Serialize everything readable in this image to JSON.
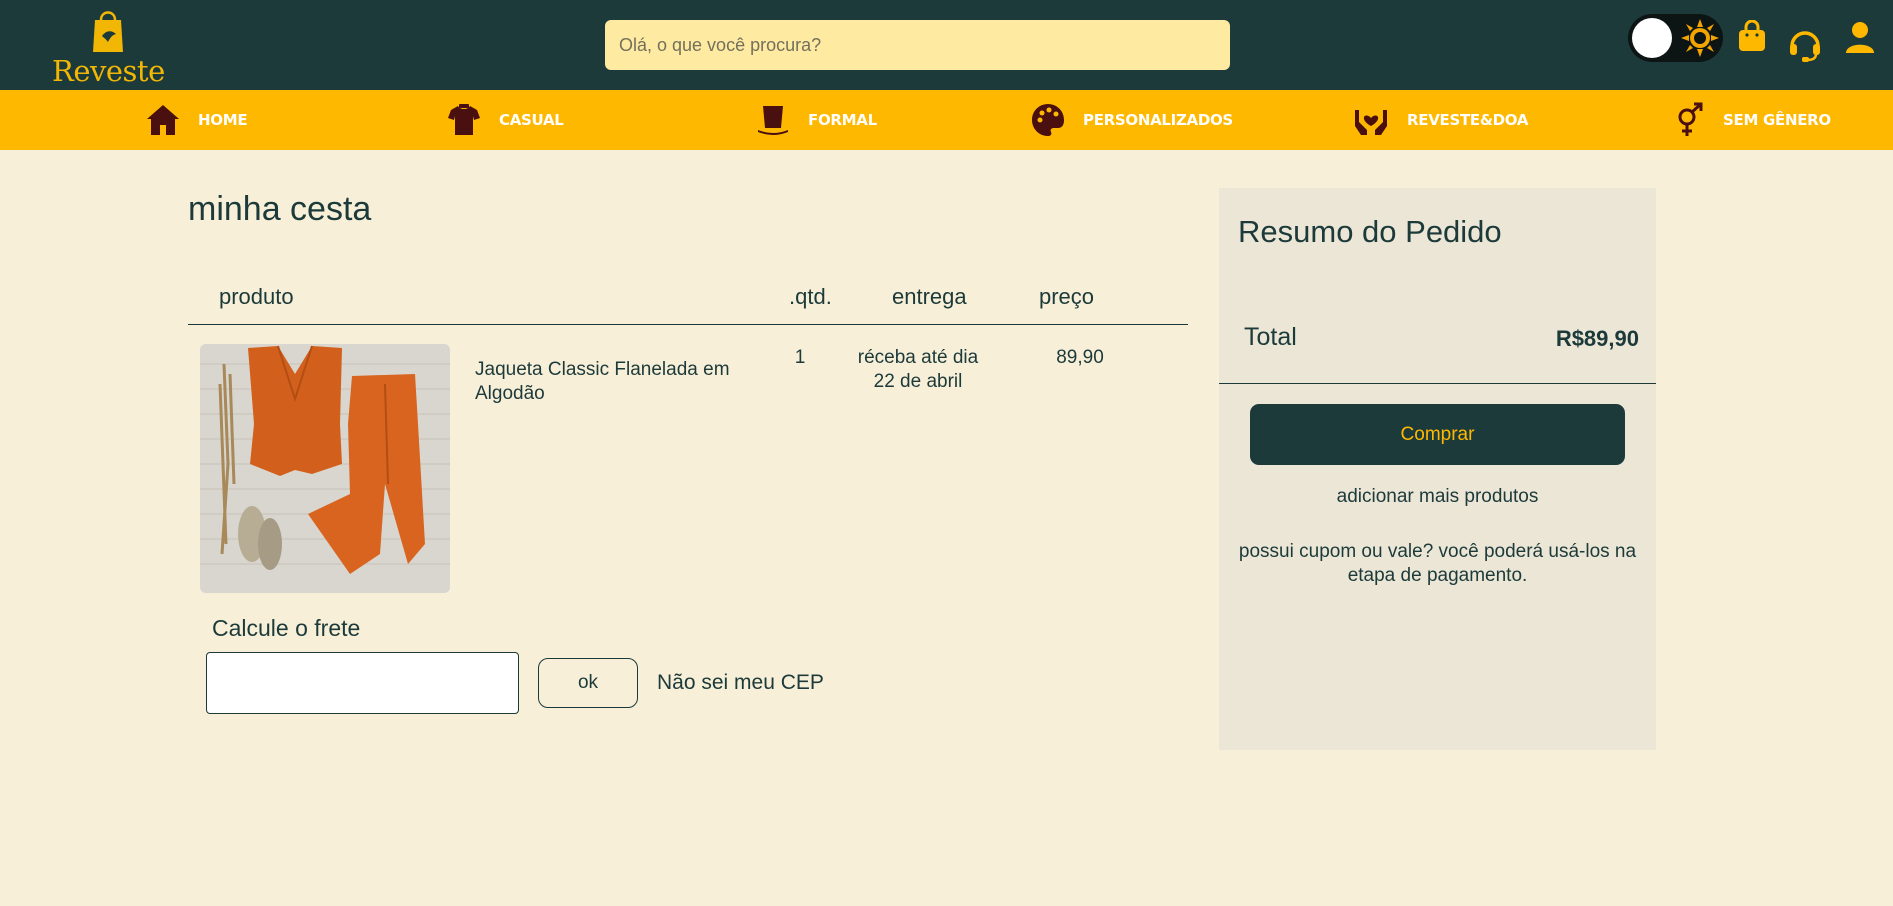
{
  "header": {
    "logo_text": "Reveste",
    "search_placeholder": "Olá, o que você procura?",
    "icons": [
      "theme-toggle",
      "sun-icon",
      "shopping-bag-icon",
      "headset-icon",
      "user-icon"
    ]
  },
  "nav": {
    "items": [
      {
        "label": "HOME",
        "icon": "home-icon"
      },
      {
        "label": "CASUAL",
        "icon": "tshirt-icon"
      },
      {
        "label": "FORMAL",
        "icon": "top-hat-icon"
      },
      {
        "label": "PERSONALIZADOS",
        "icon": "palette-icon"
      },
      {
        "label": "REVESTE&DOA",
        "icon": "hands-heart-icon"
      },
      {
        "label": "SEM GÊNERO",
        "icon": "gender-icon"
      }
    ]
  },
  "cart": {
    "title": "minha cesta",
    "columns": {
      "product": "produto",
      "qty": ".qtd.",
      "delivery": "entrega",
      "price": "preço"
    },
    "items": [
      {
        "name": "Jaqueta Classic Flanelada em Algodão",
        "qty": "1",
        "delivery": "réceba até dia 22 de abril",
        "price": "89,90"
      }
    ],
    "shipping": {
      "label": "Calcule o frete",
      "input_value": "",
      "ok_label": "ok",
      "unknown_cep": "Não sei meu CEP"
    }
  },
  "summary": {
    "title": "Resumo do Pedido",
    "total_label": "Total",
    "total_value": "R$89,90",
    "buy_label": "Comprar",
    "add_more": "adicionar mais produtos",
    "coupon_text": "possui cupom ou vale? você poderá usá-los na etapa de pagamento."
  },
  "colors": {
    "header_bg": "#1d3a3a",
    "nav_bg": "#ffb800",
    "page_bg": "#f7efd8",
    "summary_bg": "#ebe6d6",
    "accent": "#f2b705",
    "search_bg": "#feeaa1"
  }
}
